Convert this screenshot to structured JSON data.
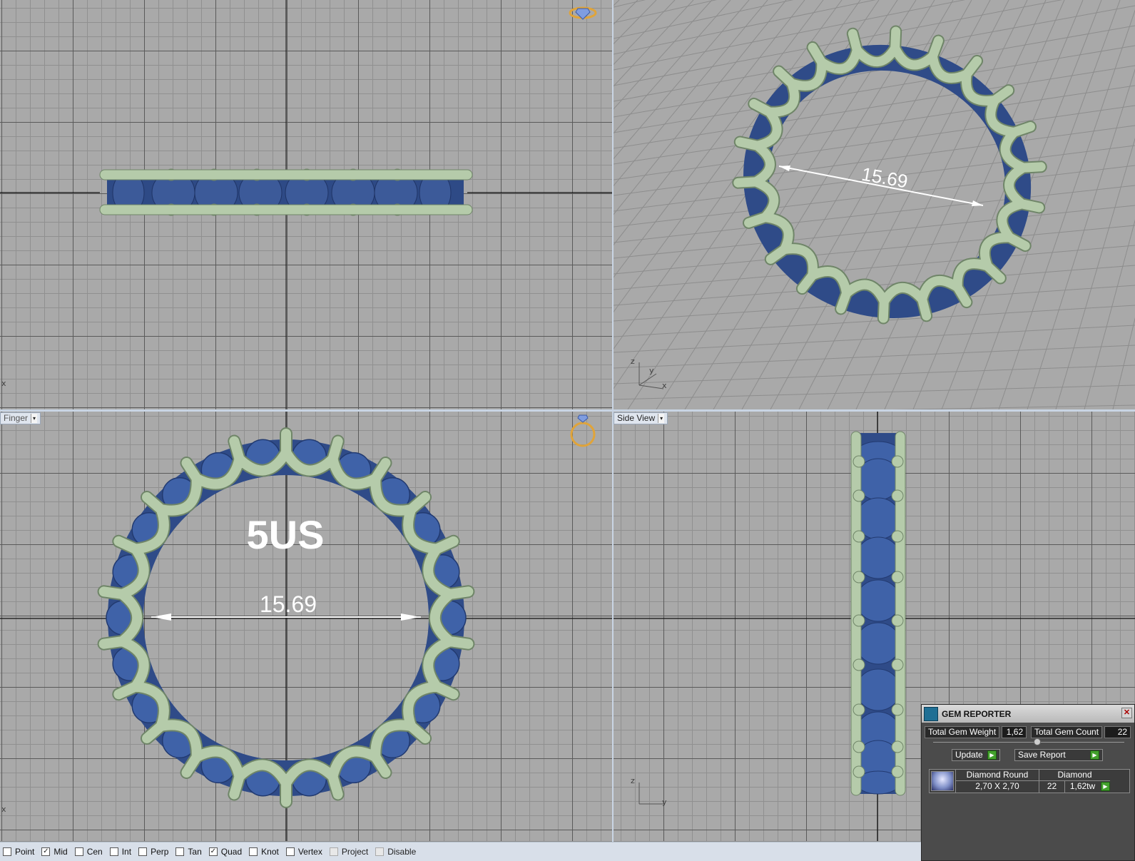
{
  "viewports": {
    "front_label": "Finger",
    "side_label": "Side View",
    "top_axes": "x",
    "persp_axes": {
      "z": "z",
      "y": "y",
      "x": "x"
    },
    "front_axes": "x",
    "side_axes": {
      "z": "z",
      "y": "y"
    }
  },
  "annotations": {
    "persp_dimension": "15.69",
    "front_dimension": "15.69",
    "ring_size": "5US"
  },
  "snaps": [
    {
      "label": "Point",
      "checked": false
    },
    {
      "label": "Mid",
      "checked": true
    },
    {
      "label": "Cen",
      "checked": false
    },
    {
      "label": "Int",
      "checked": false
    },
    {
      "label": "Perp",
      "checked": false
    },
    {
      "label": "Tan",
      "checked": false
    },
    {
      "label": "Quad",
      "checked": true
    },
    {
      "label": "Knot",
      "checked": false
    },
    {
      "label": "Vertex",
      "checked": false
    },
    {
      "label": "Project",
      "checked": false,
      "disabled": true
    },
    {
      "label": "Disable",
      "checked": false,
      "disabled": true
    }
  ],
  "gem_reporter": {
    "title": "GEM REPORTER",
    "total_weight_label": "Total Gem Weight",
    "total_weight_value": "1,62",
    "total_count_label": "Total Gem Count",
    "total_count_value": "22",
    "update_label": "Update",
    "save_label": "Save Report",
    "row": {
      "shape": "Diamond Round",
      "size": "2,70 X 2,70",
      "material": "Diamond",
      "count": "22",
      "weight": "1,62tw"
    }
  },
  "colors": {
    "metal": "#b5cbaa",
    "gem": "#3c5a99",
    "viewport_bg": "#a9a9a9"
  }
}
